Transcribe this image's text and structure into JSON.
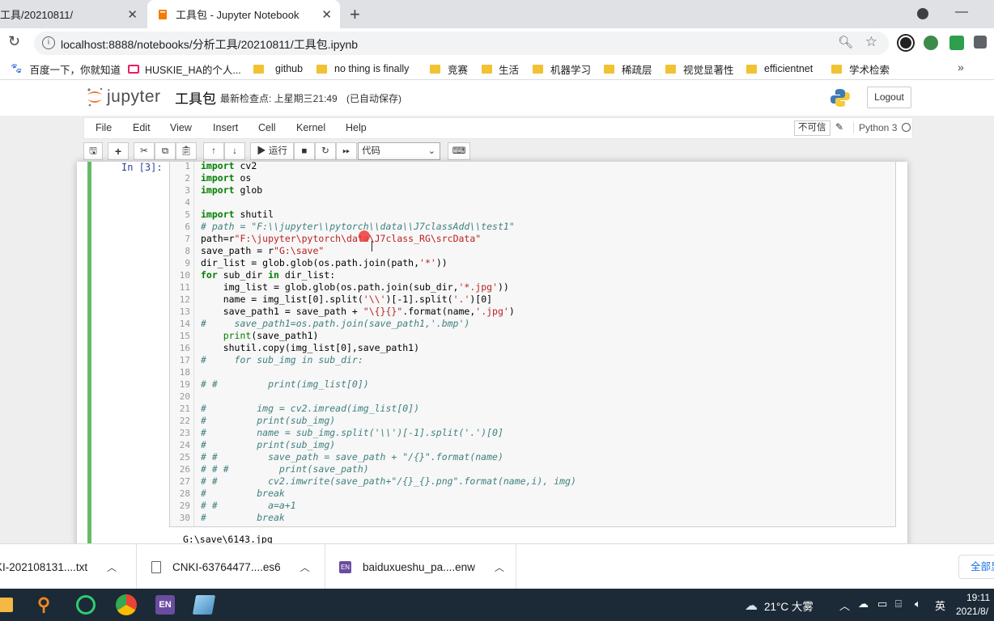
{
  "browser": {
    "tabs": [
      {
        "title": "工具/20210811/",
        "active": false
      },
      {
        "title": "工具包 - Jupyter Notebook",
        "active": true
      }
    ],
    "url": "localhost:8888/notebooks/分析工具/20210811/工具包.ipynb",
    "bookmarks": [
      {
        "label": "百度一下，你就知道",
        "icon": "paw-icon"
      },
      {
        "label": "HUSKIE_HA的个人...",
        "icon": "tv-icon"
      },
      {
        "label": "github",
        "icon": "folder-icon"
      },
      {
        "label": "no thing is finally",
        "icon": "folder-icon"
      },
      {
        "label": "竞赛",
        "icon": "folder-icon"
      },
      {
        "label": "生活",
        "icon": "folder-icon"
      },
      {
        "label": "机器学习",
        "icon": "folder-icon"
      },
      {
        "label": "稀疏层",
        "icon": "folder-icon"
      },
      {
        "label": "视觉显著性",
        "icon": "folder-icon"
      },
      {
        "label": "efficientnet",
        "icon": "folder-icon"
      },
      {
        "label": "学术检索",
        "icon": "folder-icon"
      }
    ]
  },
  "jupyter": {
    "logo_text": "jupyter",
    "notebook_name": "工具包",
    "checkpoint": "最新检查点: 上星期三21:49",
    "autosave": "(已自动保存)",
    "logout": "Logout",
    "menu": [
      "File",
      "Edit",
      "View",
      "Insert",
      "Cell",
      "Kernel",
      "Help"
    ],
    "trusted": "不可信",
    "kernel": "Python 3",
    "run_label": "运行",
    "cell_type": "代码",
    "prompt": "In  [3]:",
    "output": "G:\\save\\6143.jpg"
  },
  "code_lines": [
    "1",
    "2",
    "3",
    "4",
    "5",
    "6",
    "7",
    "8",
    "9",
    "10",
    "11",
    "12",
    "13",
    "14",
    "15",
    "16",
    "17",
    "18",
    "19",
    "20",
    "21",
    "22",
    "23",
    "24",
    "25",
    "26",
    "27",
    "28",
    "29",
    "30"
  ],
  "downloads": [
    {
      "name": "KI-202108131....txt",
      "icon": "file-icon"
    },
    {
      "name": "CNKI-63764477....es6",
      "icon": "file-icon"
    },
    {
      "name": "baiduxueshu_pa....enw",
      "icon": "endnote-icon"
    }
  ],
  "show_all": "全部显",
  "taskbar": {
    "weather": "21°C 大雾",
    "ime": "英",
    "time": "19:11",
    "date": "2021/8/"
  },
  "colors": {
    "cell_border": "#66bb6a",
    "prompt": "#303f9f",
    "keyword": "#008000",
    "comment": "#408080",
    "string": "#ba2121"
  }
}
